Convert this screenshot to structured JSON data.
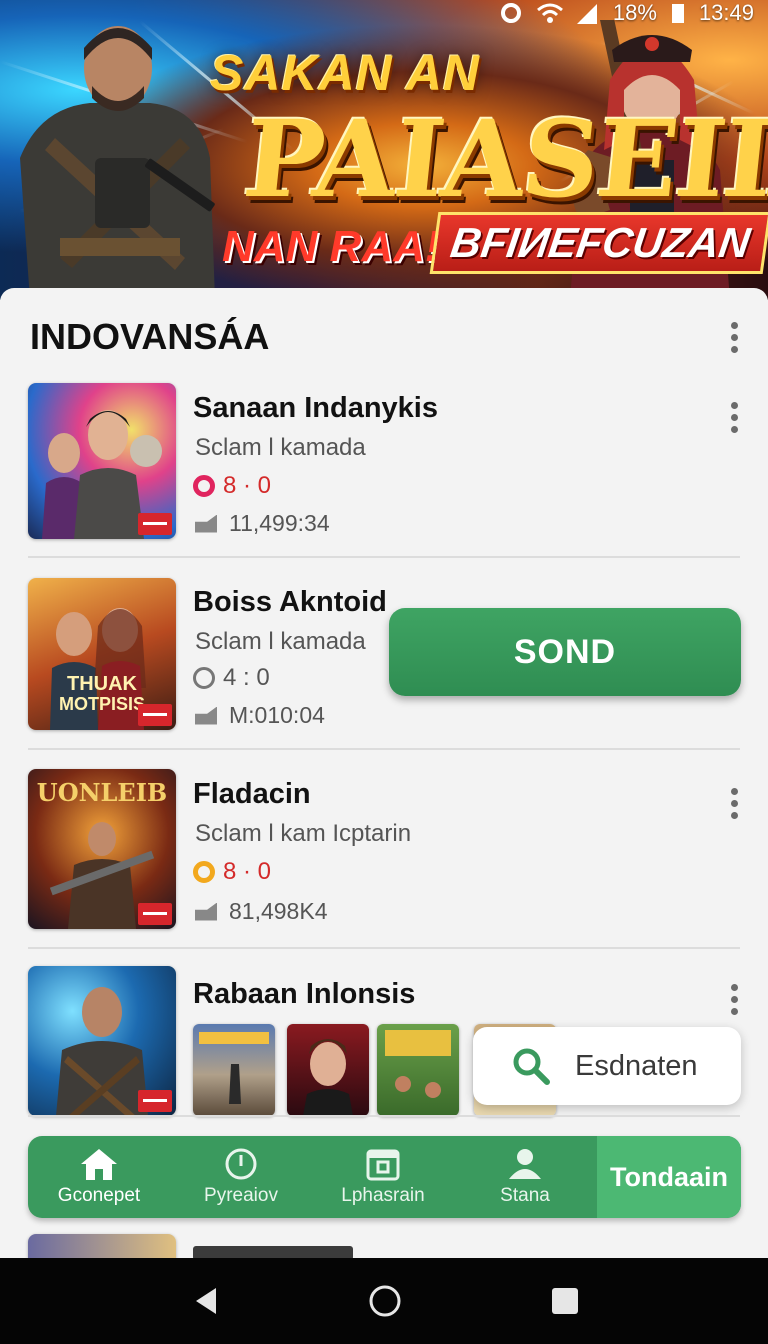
{
  "status_bar": {
    "battery": "18%",
    "time": "13:49"
  },
  "banner": {
    "title_top": "SAKAN AN",
    "title_main": "PAIASEIIA",
    "subtitle_left": "NAN RAA!",
    "subtitle_right": "BFIИEFCUZAN"
  },
  "section": {
    "title": "INDOVANSÁA"
  },
  "apps": [
    {
      "title": "Sanaan Indanykis",
      "subtitle": "Sclam l kamada",
      "rating": "8 · 0",
      "rating_color": "#e0245e",
      "downloads": "11,499:34"
    },
    {
      "title": "Boiss Akntoid",
      "subtitle": "Sclam l kamada",
      "rating": "4 : 0",
      "rating_color": "#777777",
      "downloads": "M:010:04",
      "action_button": "SOND"
    },
    {
      "title": "Fladacin",
      "subtitle": "Sclam l kam Icptarin",
      "rating": "8 · 0",
      "rating_color": "#f2a81d",
      "downloads": "81,498K4"
    },
    {
      "title": "Rabaan Inlonsis"
    }
  ],
  "search_chip": {
    "label": "Esdnaten"
  },
  "bottom_nav": {
    "tabs": [
      {
        "label": "Gconepet",
        "icon": "home-icon"
      },
      {
        "label": "Pyreaiov",
        "icon": "clock-icon"
      },
      {
        "label": "Lphasrain",
        "icon": "calendar-icon"
      },
      {
        "label": "Stana",
        "icon": "user-icon"
      }
    ],
    "active_label": "Tondaain"
  },
  "colors": {
    "accent_green": "#3a9a5e",
    "button_green": "#2f8d52"
  }
}
